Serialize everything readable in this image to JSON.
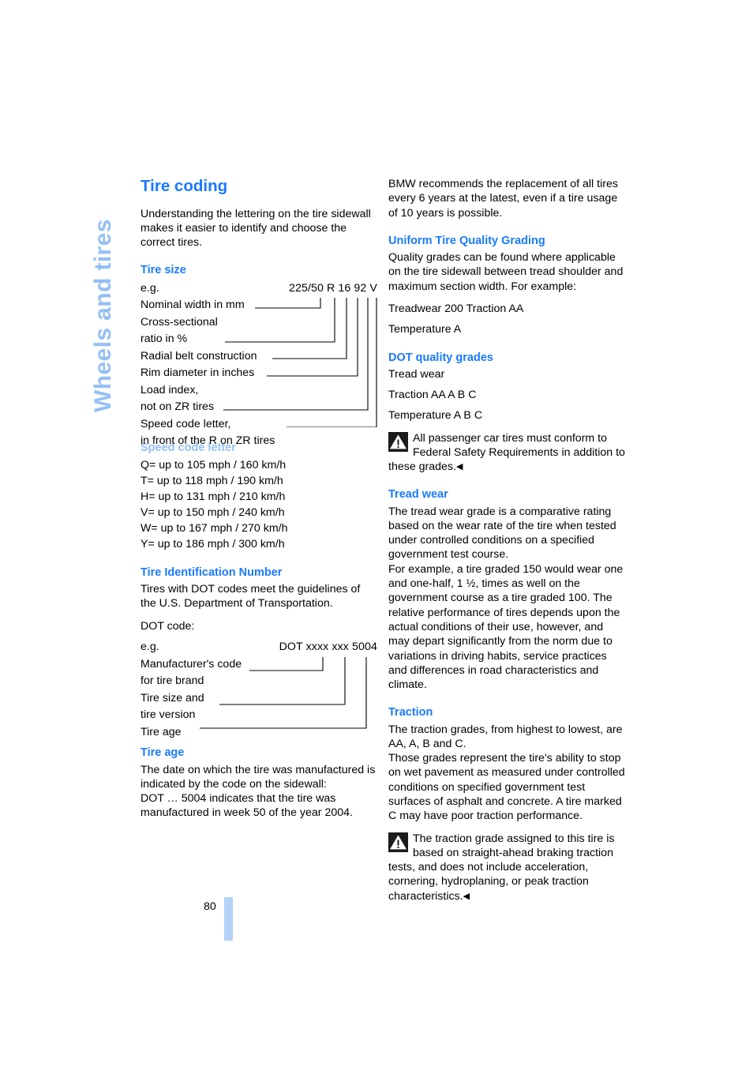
{
  "chapter_tab": {
    "label": "Wheels and tires"
  },
  "colors": {
    "heading_blue": "#1a7aff",
    "light_blue": "#94bff5",
    "page_rule_blue": "#b5d2f7"
  },
  "left_column": {
    "title": "Tire coding",
    "intro": "Understanding the lettering on the tire sidewall makes it easier to identify and choose the correct tires.",
    "tire_size": {
      "heading": "Tire size",
      "eg_label": "e.g.",
      "example_code": "225/50 R 16 92 V",
      "rows": [
        "Nominal width in mm",
        "Cross-sectional",
        "ratio in %",
        "Radial belt construction",
        "Rim diameter in inches",
        "Load index,",
        "not on ZR tires",
        "Speed code letter,",
        "in front of the R on ZR tires"
      ]
    },
    "speed_code": {
      "heading": "Speed code letter",
      "entries": [
        "Q= up to 105 mph / 160 km/h",
        "T= up to 118 mph / 190 km/h",
        "H= up to 131 mph / 210 km/h",
        "V= up to 150 mph / 240 km/h",
        "W= up to 167 mph / 270 km/h",
        "Y= up to 186 mph / 300 km/h"
      ]
    },
    "tin": {
      "heading": "Tire Identification Number",
      "intro": "Tires with DOT codes meet the guidelines of the U.S. Department of Transportation.",
      "dot_code_label": "DOT code:",
      "eg_label": "e.g.",
      "example_code": "DOT xxxx xxx 5004",
      "rows": [
        "Manufacturer's code",
        "for tire brand",
        "Tire size and",
        "tire version",
        "Tire age"
      ]
    },
    "tire_age": {
      "heading": "Tire age",
      "text": "The date on which the tire was manufactured is indicated by the code on the sidewall:",
      "text2": "DOT … 5004 indicates that the tire was manufactured in week 50 of the year 2004."
    }
  },
  "right_column": {
    "intro": "BMW recommends the replacement of all tires every 6 years at the latest, even if a tire usage of 10 years is possible.",
    "utqg": {
      "heading": "Uniform Tire Quality Grading",
      "text": "Quality grades can be found where applicable on the tire sidewall between tread shoulder and maximum section width. For example:",
      "line1": "Treadwear 200 Traction AA",
      "line2": "Temperature A"
    },
    "dot_grades": {
      "heading": "DOT quality grades",
      "line1": "Tread wear",
      "line2": "Traction AA A B C",
      "line3": "Temperature A B C",
      "note": "All passenger car tires must conform to Federal Safety Requirements in addition to these grades.",
      "note_end": "◀"
    },
    "tread_wear": {
      "heading": "Tread wear",
      "text1": "The tread wear grade is a comparative rating based on the wear rate of the tire when tested under controlled conditions on a specified government test course.",
      "text2": "For example, a tire graded 150 would wear one and one-half, 1 ½, times as well on the government course as a tire graded 100. The relative performance of tires depends upon the actual conditions of their use, however, and may depart significantly from the norm due to variations in driving habits, service practices and differences in road characteristics and climate."
    },
    "traction": {
      "heading": "Traction",
      "text1": "The traction grades, from highest to lowest, are AA, A, B and C.",
      "text2": "Those grades represent the tire's ability to stop on wet pavement as measured under controlled conditions on specified government test surfaces of asphalt and concrete. A tire marked C may have poor traction performance.",
      "note": "The traction grade assigned to this tire is based on straight-ahead braking traction tests, and does not include acceleration, cornering, hydroplaning, or peak traction characteristics.",
      "note_end": "◀"
    }
  },
  "footer": {
    "page_number": "80"
  }
}
